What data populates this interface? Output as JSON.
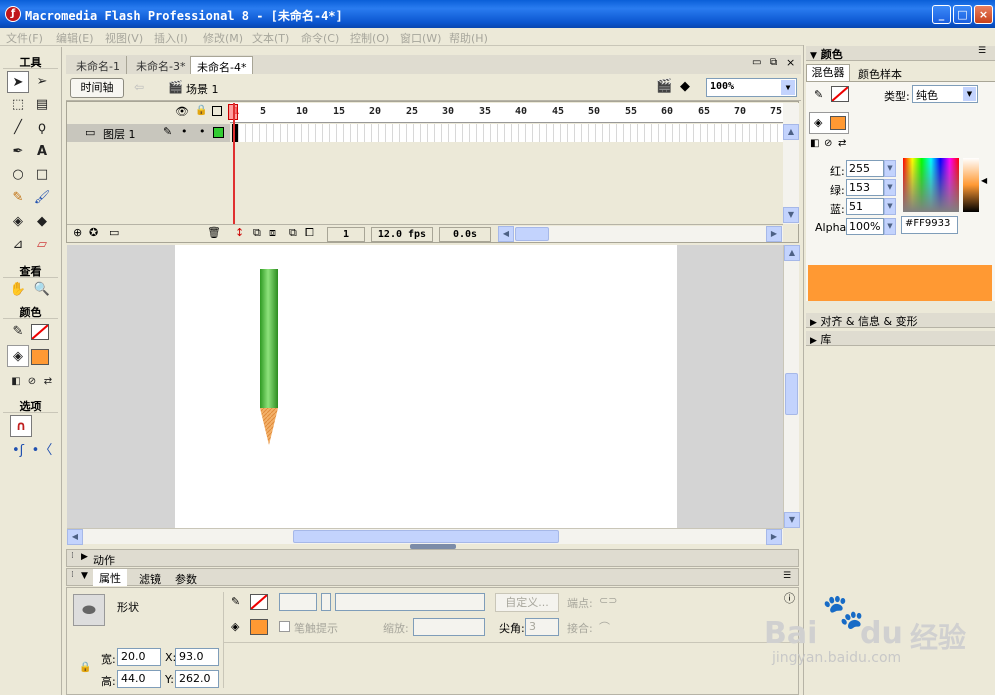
{
  "window": {
    "title": "Macromedia Flash Professional 8 - [未命名-4*]"
  },
  "menu": [
    "文件(F)",
    "编辑(E)",
    "视图(V)",
    "插入(I)",
    "修改(M)",
    "文本(T)",
    "命令(C)",
    "控制(O)",
    "窗口(W)",
    "帮助(H)"
  ],
  "tools": {
    "header": "工具",
    "view_header": "查看",
    "color_header": "颜色",
    "options_header": "选项"
  },
  "doc_tabs": [
    "未命名-1",
    "未命名-3*",
    "未命名-4*"
  ],
  "doc_controls": {
    "timeline_btn": "时间轴",
    "scene": "场景 1",
    "zoom": "100%"
  },
  "timeline": {
    "ruler": [
      "1",
      "5",
      "10",
      "15",
      "20",
      "25",
      "30",
      "35",
      "40",
      "45",
      "50",
      "55",
      "60",
      "65",
      "70",
      "75"
    ],
    "layer_name": "图层 1",
    "current_frame": "1",
    "fps": "12.0 fps",
    "elapsed": "0.0s"
  },
  "panels": {
    "actions": "动作",
    "props_tabs": [
      "属性",
      "滤镜",
      "参数"
    ]
  },
  "props": {
    "shape_label": "形状",
    "custom_btn": "自定义...",
    "endpoint_label": "端点:",
    "stroke_hint": "笔触提示",
    "scale_label": "缩放:",
    "miter_label": "尖角:",
    "miter_value": "3",
    "join_label": "接合:",
    "w_label": "宽:",
    "w": "20.0",
    "h_label": "高:",
    "h": "44.0",
    "x_label": "X:",
    "x": "93.0",
    "y_label": "Y:",
    "y": "262.0"
  },
  "color_panel": {
    "title": "颜色",
    "tabs": [
      "混色器",
      "颜色样本"
    ],
    "type_label": "类型:",
    "type_value": "纯色",
    "red_label": "红:",
    "red": "255",
    "green_label": "绿:",
    "green": "153",
    "blue_label": "蓝:",
    "blue": "51",
    "alpha_label": "Alpha:",
    "alpha": "100%",
    "hex": "#FF9933",
    "fill_color": "#FF9933"
  },
  "collapsed_panels": [
    "对齐 & 信息 & 变形",
    "库"
  ],
  "watermark": {
    "brand": "Bai",
    "brand2": "du",
    "tag": "经验",
    "url": "jingyan.baidu.com"
  }
}
